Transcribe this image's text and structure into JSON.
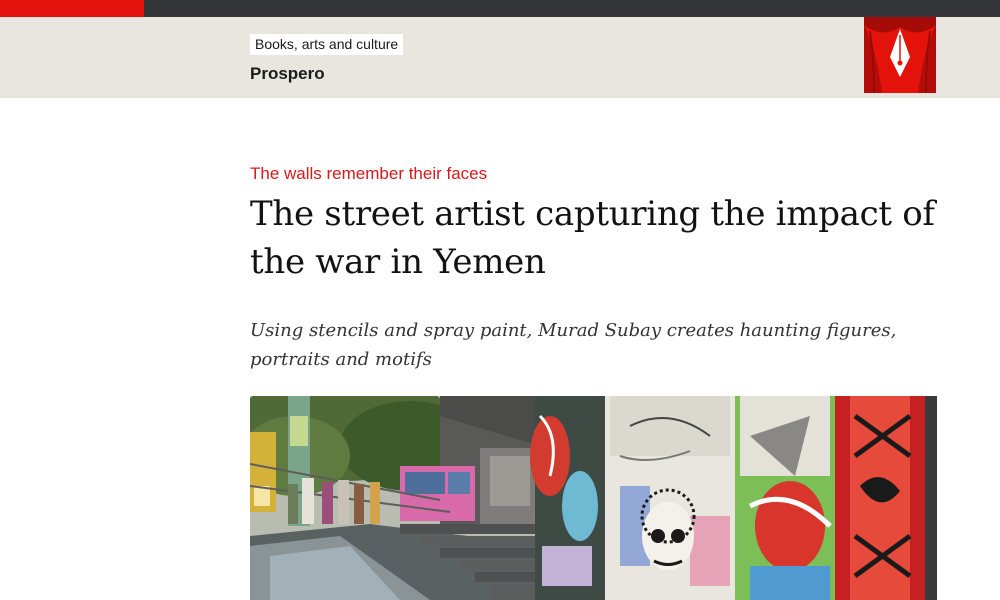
{
  "colors": {
    "brand_red": "#e3120b",
    "kicker_red": "#d7191c",
    "band_beige": "#e9e5df",
    "topbar_dark": "#333538"
  },
  "section": {
    "tag": "Books, arts and culture",
    "title": "Prospero",
    "logo_icon": "prospero-theatre-curtain-pen-nib-icon"
  },
  "article": {
    "kicker": "The walls remember their faces",
    "headline": "The street artist capturing the impact of the war in Yemen",
    "standfirst": "Using stencils and spray paint, Murad Subay creates haunting figures, portraits and motifs",
    "image_icon": "graffiti-underpass-photo"
  }
}
